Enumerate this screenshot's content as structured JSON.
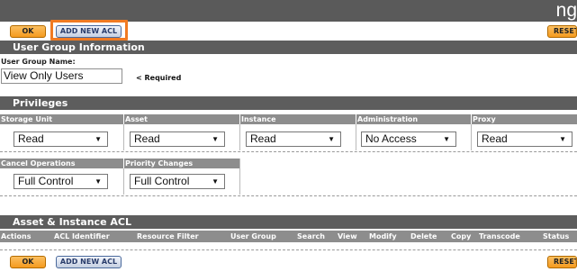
{
  "topbar": {
    "text": "ng"
  },
  "toolbar": {
    "ok_label": "OK",
    "add_acl_label": "ADD NEW ACL",
    "reset_label": "RESET"
  },
  "user_group": {
    "title": "User Group Information",
    "name_label": "User Group Name:",
    "name_value": "View Only Users",
    "required_label": "< Required"
  },
  "privileges": {
    "title": "Privileges",
    "row1": [
      {
        "label": "Storage Unit",
        "value": "Read"
      },
      {
        "label": "Asset",
        "value": "Read"
      },
      {
        "label": "Instance",
        "value": "Read"
      },
      {
        "label": "Administration",
        "value": "No Access"
      },
      {
        "label": "Proxy",
        "value": "Read"
      }
    ],
    "row2": [
      {
        "label": "Cancel Operations",
        "value": "Full Control"
      },
      {
        "label": "Priority Changes",
        "value": "Full Control"
      }
    ]
  },
  "acl": {
    "title": "Asset & Instance ACL",
    "columns": [
      "Actions",
      "ACL Identifier",
      "Resource Filter",
      "User Group",
      "Search",
      "View",
      "Modify",
      "Delete",
      "Copy",
      "Transcode",
      "Status"
    ]
  },
  "icons": {
    "dropdown": "chevron-down-icon"
  },
  "colors": {
    "ok_button": "#f59a1e",
    "add_acl_button": "#c4cfe2",
    "highlight": "#f07a22",
    "section_header": "#5d5d5d",
    "column_header": "#8d8d8d"
  }
}
